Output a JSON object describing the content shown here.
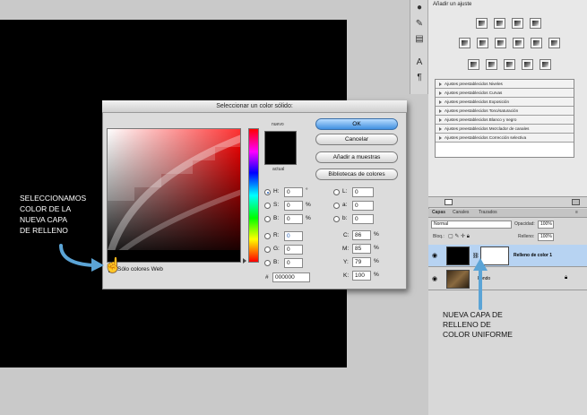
{
  "adjustments_panel": {
    "title": "Añadir un ajuste",
    "presets": [
      "Ajustes preestablecidos Niveles",
      "Ajustes preestablecidos Curvas",
      "Ajustes preestablecidos Exposición",
      "Ajustes preestablecidos Tono/saturación",
      "Ajustes preestablecidos Blanco y negro",
      "Ajustes preestablecidos Mezclador de canales",
      "Ajustes preestablecidos Corrección selectiva"
    ]
  },
  "layers_panel": {
    "tabs": [
      "Capas",
      "Canales",
      "Trazados"
    ],
    "blend_mode": "Normal",
    "opacity_label": "Opacidad:",
    "opacity_value": "100%",
    "lock_label": "Bloq.:",
    "fill_label": "Relleno:",
    "fill_value": "100%",
    "layers": [
      {
        "name": "Relleno de color 1",
        "selected": true
      },
      {
        "name": "Fondo",
        "selected": false
      }
    ]
  },
  "color_picker": {
    "title": "Seleccionar un color sólido:",
    "new_label": "nuevo",
    "current_label": "actual",
    "buttons": {
      "ok": "OK",
      "cancel": "Cancelar",
      "add_swatches": "Añadir a muestras",
      "libraries": "Bibliotecas de colores"
    },
    "web_colors_label": "Sólo colores Web",
    "fields": {
      "H": {
        "value": "0",
        "unit": "°"
      },
      "S": {
        "value": "0",
        "unit": "%"
      },
      "B": {
        "value": "0",
        "unit": "%"
      },
      "R": {
        "value": "0",
        "unit": ""
      },
      "G": {
        "value": "0",
        "unit": ""
      },
      "Bb": {
        "value": "0",
        "unit": ""
      },
      "L": {
        "value": "0"
      },
      "a": {
        "value": "0"
      },
      "b": {
        "value": "0"
      },
      "C": {
        "value": "86",
        "unit": "%"
      },
      "M": {
        "value": "85",
        "unit": "%"
      },
      "Y": {
        "value": "79",
        "unit": "%"
      },
      "K": {
        "value": "100",
        "unit": "%"
      }
    },
    "hex_label": "#",
    "hex_value": "000000"
  },
  "annotations": {
    "left": [
      "SELECCIONAMOS",
      "COLOR DE LA",
      "NUEVA CAPA",
      "DE RELLENO"
    ],
    "right": [
      "NUEVA CAPA DE",
      "RELLENO DE",
      "COLOR UNIFORME"
    ]
  },
  "colors": {
    "accent": "#5ba4d6",
    "selected_layer": "#b7d3f2"
  }
}
